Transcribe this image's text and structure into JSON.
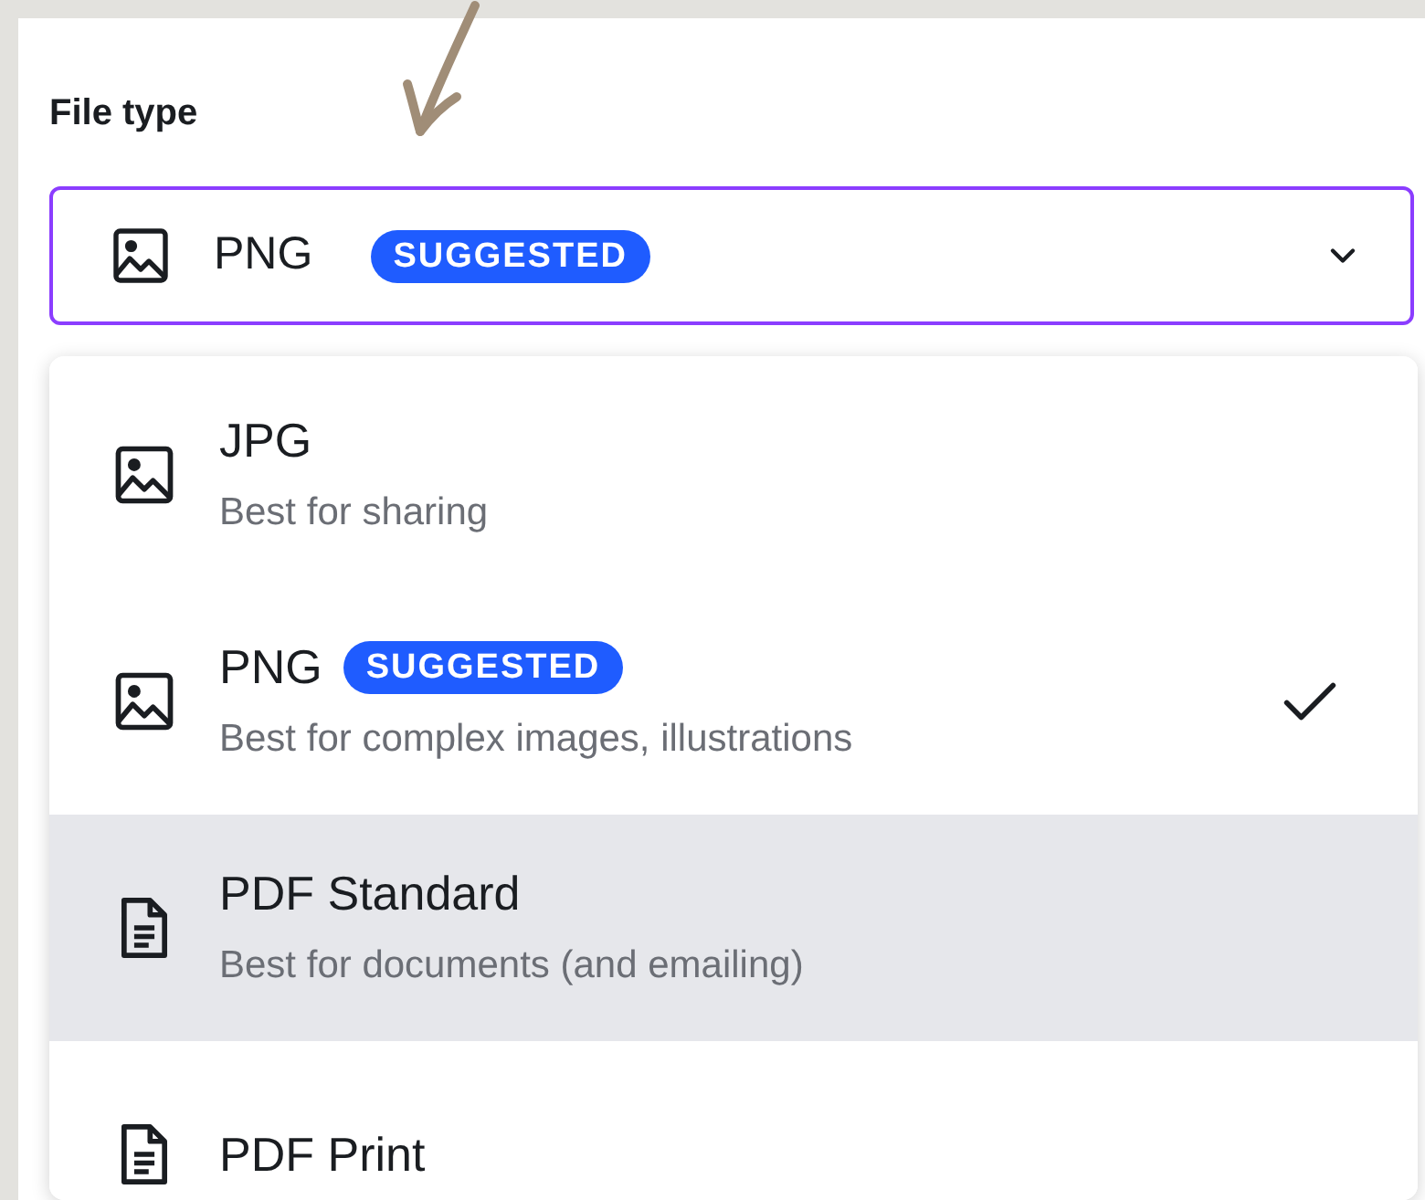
{
  "field_label": "File type",
  "select": {
    "value": "PNG",
    "badge": "SUGGESTED",
    "kind": "image",
    "expanded": true
  },
  "options": [
    {
      "kind": "image",
      "label": "JPG",
      "description": "Best for sharing",
      "selected": false,
      "highlighted": false
    },
    {
      "kind": "image",
      "label": "PNG",
      "badge": "SUGGESTED",
      "description": "Best for complex images, illustrations",
      "selected": true,
      "highlighted": false
    },
    {
      "kind": "document",
      "label": "PDF Standard",
      "description": "Best for documents (and emailing)",
      "selected": false,
      "highlighted": true
    },
    {
      "kind": "document",
      "label": "PDF Print",
      "selected": false,
      "highlighted": false
    }
  ]
}
